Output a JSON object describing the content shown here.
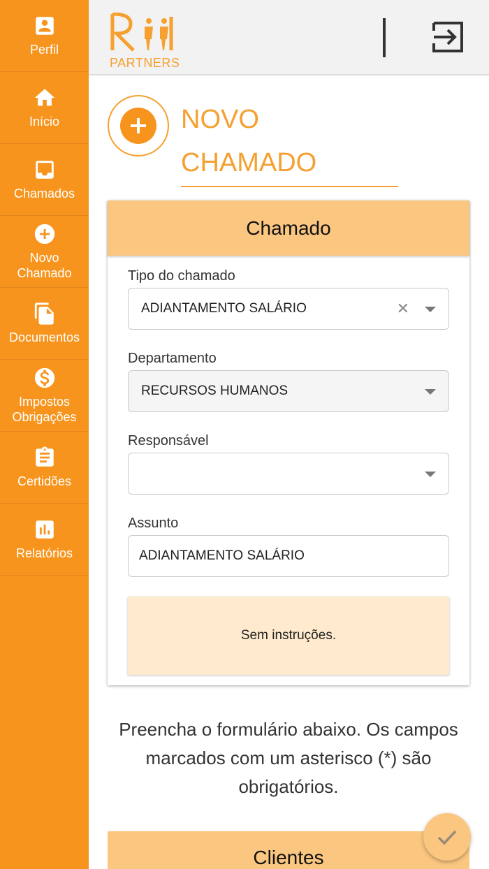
{
  "sidebar": {
    "items": [
      {
        "label": "Perfil",
        "icon": "profile-icon"
      },
      {
        "label": "Início",
        "icon": "home-icon"
      },
      {
        "label": "Chamados",
        "icon": "inbox-icon"
      },
      {
        "label": "Novo\nChamado",
        "icon": "add-circle-icon"
      },
      {
        "label": "Documentos",
        "icon": "documents-icon"
      },
      {
        "label": "Impostos\nObrigações",
        "icon": "dollar-icon"
      },
      {
        "label": "Certidões",
        "icon": "clipboard-icon"
      },
      {
        "label": "Relatórios",
        "icon": "bar-chart-icon"
      }
    ]
  },
  "header": {
    "logo_text": "PARTNERS",
    "logout_icon": "logout-icon"
  },
  "page": {
    "title": "NOVO\nCHAMADO"
  },
  "form": {
    "card_title": "Chamado",
    "tipo": {
      "label": "Tipo do chamado",
      "value": "ADIANTAMENTO SALÁRIO"
    },
    "departamento": {
      "label": "Departamento",
      "value": "RECURSOS HUMANOS"
    },
    "responsavel": {
      "label": "Responsável",
      "value": ""
    },
    "assunto": {
      "label": "Assunto",
      "value": "ADIANTAMENTO SALÁRIO"
    },
    "instructions": "Sem instruções."
  },
  "help_text": "Preencha o formulário abaixo. Os campos marcados com um asterisco (*) são obrigatórios.",
  "clientes_card_title": "Clientes",
  "colors": {
    "sidebar": "#f7941d",
    "accent": "#f5a030",
    "card_header": "#fbc680",
    "instructions_bg": "#ffeacd"
  }
}
